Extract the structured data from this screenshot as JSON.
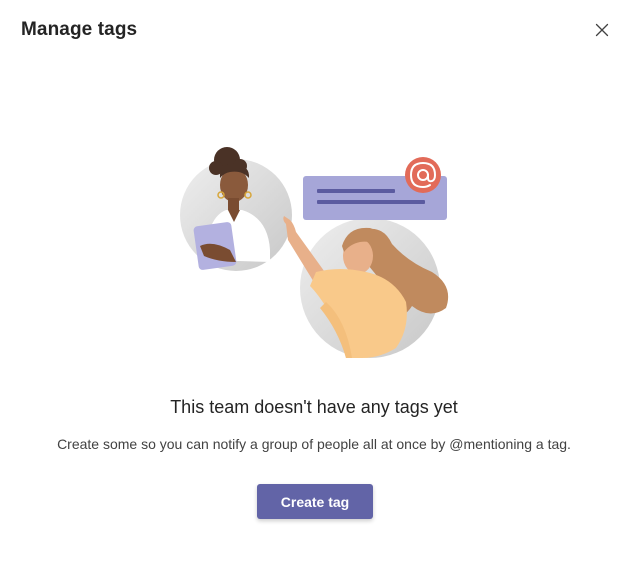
{
  "dialog": {
    "title": "Manage tags",
    "close_icon": "close-icon"
  },
  "empty_state": {
    "illustration": "people-mention-illustration",
    "heading": "This team doesn't have any tags yet",
    "description": "Create some so you can notify a group of people all at once by @mentioning a tag."
  },
  "actions": {
    "create_label": "Create tag"
  },
  "colors": {
    "accent": "#6264a7",
    "mention_badge": "#e26b59",
    "message_bubble": "#a6a6d8"
  }
}
